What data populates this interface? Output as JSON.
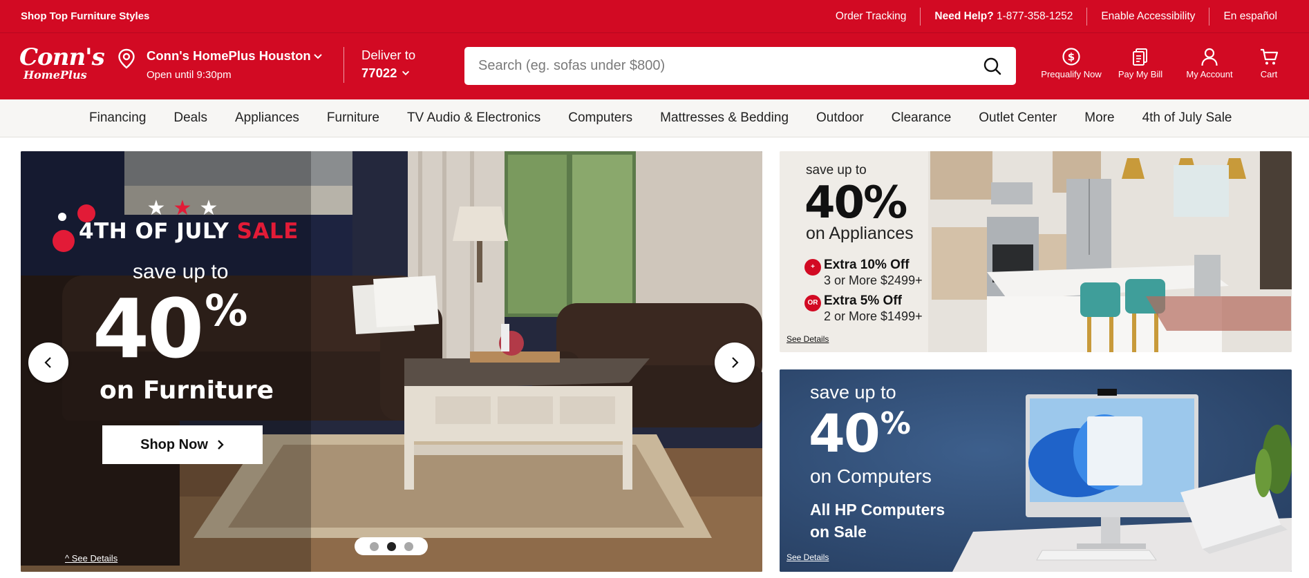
{
  "utility_bar": {
    "promo": "Shop Top Furniture Styles",
    "order_tracking": "Order Tracking",
    "need_help_label": "Need Help?",
    "phone": "1-877-358-1252",
    "accessibility": "Enable Accessibility",
    "language": "En español"
  },
  "header": {
    "logo_top": "Conn's",
    "logo_bottom": "HomePlus",
    "store_name": "Conn's HomePlus Houston",
    "store_hours": "Open until 9:30pm",
    "deliver_label": "Deliver to",
    "zip": "77022",
    "search_placeholder": "Search (eg. sofas under $800)",
    "icons": [
      {
        "label": "Prequalify Now",
        "icon": "dollar-coin-icon"
      },
      {
        "label": "Pay My Bill",
        "icon": "bill-icon"
      },
      {
        "label": "My Account",
        "icon": "user-icon"
      },
      {
        "label": "Cart",
        "icon": "cart-icon"
      }
    ]
  },
  "nav": {
    "categories": [
      "Financing",
      "Deals",
      "Appliances",
      "Furniture",
      "TV Audio & Electronics",
      "Computers",
      "Mattresses & Bedding",
      "Outdoor",
      "Clearance",
      "Outlet Center",
      "More",
      "4th of July Sale"
    ]
  },
  "hero": {
    "sale_white": "4TH OF JULY",
    "sale_red": "SALE",
    "save_up_to": "save up to",
    "percent_value": "40",
    "percent_symbol": "%",
    "on_text": "on Furniture",
    "cta": "Shop Now",
    "details": "^ See Details",
    "slides": 3,
    "active_slide": 2
  },
  "promo_appliances": {
    "save_up_to": "save up to",
    "percent": "40%",
    "on_text": "on Appliances",
    "offer1_badge": "+",
    "offer1_title": "Extra 10% Off",
    "offer1_sub": "3 or More $2499+",
    "offer2_badge": "OR",
    "offer2_title": "Extra 5% Off",
    "offer2_sub": "2 or More $1499+",
    "details": "See Details"
  },
  "promo_computers": {
    "save_up_to": "save up to",
    "percent_value": "40",
    "percent_symbol": "%",
    "on_text": "on Computers",
    "hp_line1": "All HP Computers",
    "hp_line2": "on Sale",
    "details": "See Details"
  },
  "colors": {
    "brand_red": "#d20a23",
    "nav_bg": "#f7f6f4",
    "computer_banner_bg": "#2e4a72"
  }
}
